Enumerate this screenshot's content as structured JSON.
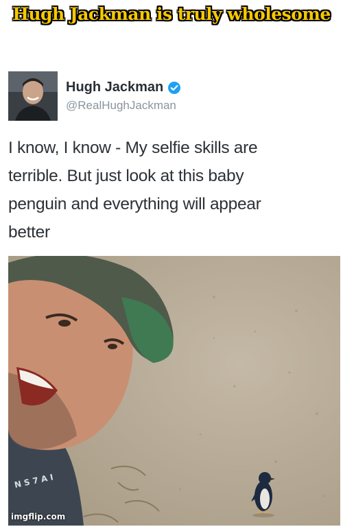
{
  "meme": {
    "caption": "Hugh Jackman is truly wholesome",
    "watermark": "imgflip.com"
  },
  "tweet": {
    "display_name": "Hugh Jackman",
    "handle": "@RealHughJackman",
    "verified": true,
    "text_lines": [
      "I know, I know - My selfie skills are",
      "terrible. But just look at this baby",
      "penguin and everything will appear",
      "better"
    ],
    "photo": {
      "shirt_print": "N S 7 A I"
    }
  },
  "colors": {
    "caption_fill": "#f6c800",
    "caption_outline": "#000000",
    "verified_badge": "#1da1f2",
    "name_text": "#2a2f34",
    "handle_text": "#8a949c",
    "ground": "#b9ae9b"
  },
  "icons": {
    "verified": "verified-badge-icon"
  }
}
